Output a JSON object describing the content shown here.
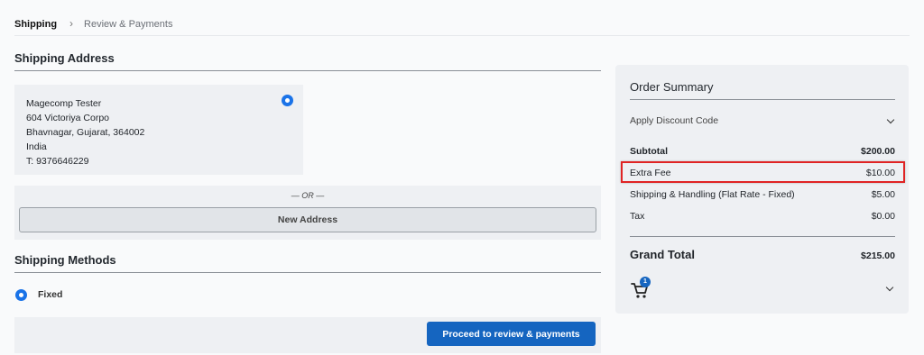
{
  "breadcrumb": {
    "step_current": "Shipping",
    "separator": "›",
    "step_next": "Review & Payments"
  },
  "shipping_address": {
    "title": "Shipping Address",
    "selected_address": [
      "Magecomp Tester",
      "604 Victoriya Corpo",
      "Bhavnagar, Gujarat, 364002",
      "India",
      "T: 9376646229"
    ],
    "or_label": "— OR —",
    "new_address_label": "New Address"
  },
  "shipping_methods": {
    "title": "Shipping Methods",
    "selected_method": "Fixed",
    "proceed_label": "Proceed to review & payments"
  },
  "order_summary": {
    "title": "Order Summary",
    "discount_label": "Apply Discount Code",
    "rows": [
      {
        "label": "Subtotal",
        "value": "$200.00"
      },
      {
        "label": "Extra Fee",
        "value": "$10.00"
      },
      {
        "label": "Shipping & Handling (Flat Rate - Fixed)",
        "value": "$5.00"
      },
      {
        "label": "Tax",
        "value": "$0.00"
      }
    ],
    "grand_total_label": "Grand Total",
    "grand_total_value": "$215.00",
    "cart_count": "1"
  },
  "colors": {
    "accent": "#1565c0",
    "highlight": "#e02424"
  },
  "icons": [
    "chevron-right-icon",
    "chevron-down-icon",
    "cart-icon",
    "radio-selected-icon"
  ]
}
